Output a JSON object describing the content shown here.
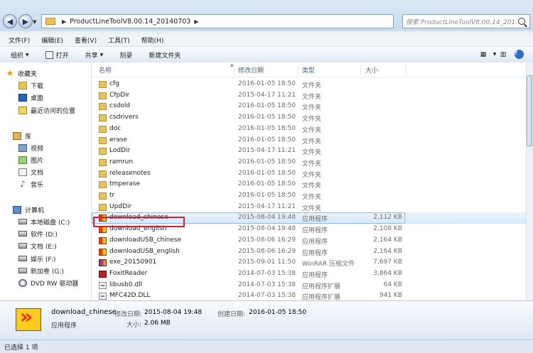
{
  "address": {
    "path": "ProductLineToolV8.00.14_20140703"
  },
  "search": {
    "placeholder": "搜索 ProductLineToolV8.00.14_201..."
  },
  "menu": [
    "文件(F)",
    "编辑(E)",
    "查看(V)",
    "工具(T)",
    "帮助(H)"
  ],
  "toolbar": {
    "organize": "组织",
    "open": "打开",
    "share": "共享",
    "burn": "刻录",
    "new_folder": "新建文件夹"
  },
  "nav": {
    "favorites": "收藏夹",
    "downloads": "下载",
    "desktop": "桌面",
    "recent": "最近访问的位置",
    "libraries": "库",
    "videos": "视频",
    "pictures": "图片",
    "documents": "文档",
    "music": "音乐",
    "computer": "计算机",
    "drive_c": "本地磁盘 (C:)",
    "drive_d": "软件 (D:)",
    "drive_e": "文档 (E:)",
    "drive_f": "娱乐 (F:)",
    "drive_g": "新加卷 (G:)",
    "dvd": "DVD RW 驱动器"
  },
  "columns": {
    "name": "名称",
    "date": "修改日期",
    "type": "类型",
    "size": "大小"
  },
  "files": [
    {
      "name": "cfg",
      "date": "2016-01-05 18:50",
      "type": "文件夹",
      "size": "",
      "icon": "folder"
    },
    {
      "name": "CfpDir",
      "date": "2015-04-17 11:21",
      "type": "文件夹",
      "size": "",
      "icon": "folder"
    },
    {
      "name": "csdold",
      "date": "2016-01-05 18:50",
      "type": "文件夹",
      "size": "",
      "icon": "folder"
    },
    {
      "name": "csdrivers",
      "date": "2016-01-05 18:50",
      "type": "文件夹",
      "size": "",
      "icon": "folder"
    },
    {
      "name": "doc",
      "date": "2016-01-05 18:50",
      "type": "文件夹",
      "size": "",
      "icon": "folder"
    },
    {
      "name": "erase",
      "date": "2016-01-05 18:50",
      "type": "文件夹",
      "size": "",
      "icon": "folder"
    },
    {
      "name": "LodDir",
      "date": "2015-04-17 11:21",
      "type": "文件夹",
      "size": "",
      "icon": "folder"
    },
    {
      "name": "ramrun",
      "date": "2016-01-05 18:50",
      "type": "文件夹",
      "size": "",
      "icon": "folder"
    },
    {
      "name": "releasenotes",
      "date": "2016-01-05 18:50",
      "type": "文件夹",
      "size": "",
      "icon": "folder"
    },
    {
      "name": "tmperase",
      "date": "2016-01-05 18:50",
      "type": "文件夹",
      "size": "",
      "icon": "folder"
    },
    {
      "name": "tr",
      "date": "2016-01-05 18:50",
      "type": "文件夹",
      "size": "",
      "icon": "folder"
    },
    {
      "name": "UpdDir",
      "date": "2015-04-17 11:21",
      "type": "文件夹",
      "size": "",
      "icon": "folder"
    },
    {
      "name": "download_chinese",
      "date": "2015-08-04 19:48",
      "type": "应用程序",
      "size": "2,112 KB",
      "icon": "app"
    },
    {
      "name": "download_english",
      "date": "2015-08-04 19:48",
      "type": "应用程序",
      "size": "2,108 KB",
      "icon": "app"
    },
    {
      "name": "downloadUSB_chinese",
      "date": "2015-08-06 16:29",
      "type": "应用程序",
      "size": "2,164 KB",
      "icon": "app"
    },
    {
      "name": "downloadUSB_english",
      "date": "2015-08-06 16:29",
      "type": "应用程序",
      "size": "2,164 KB",
      "icon": "app"
    },
    {
      "name": "exe_20150901",
      "date": "2015-09-01 11:50",
      "type": "WinRAR 压缩文件",
      "size": "7,697 KB",
      "icon": "rar"
    },
    {
      "name": "FoxitReader",
      "date": "2014-07-03 15:38",
      "type": "应用程序",
      "size": "3,864 KB",
      "icon": "foxit"
    },
    {
      "name": "libusb0.dll",
      "date": "2014-07-03 15:38",
      "type": "应用程序扩展",
      "size": "64 KB",
      "icon": "dll"
    },
    {
      "name": "MFC42D.DLL",
      "date": "2014-07-03 15:38",
      "type": "应用程序扩展",
      "size": "941 KB",
      "icon": "dll"
    }
  ],
  "selected_index": 12,
  "details": {
    "name": "download_chinese",
    "type": "应用程序",
    "modified_label": "修改日期:",
    "modified": "2015-08-04 19:48",
    "created_label": "创建日期:",
    "created": "2016-01-05 18:50",
    "size_label": "大小:",
    "size": "2.06 MB"
  },
  "status": "已选择 1 项"
}
